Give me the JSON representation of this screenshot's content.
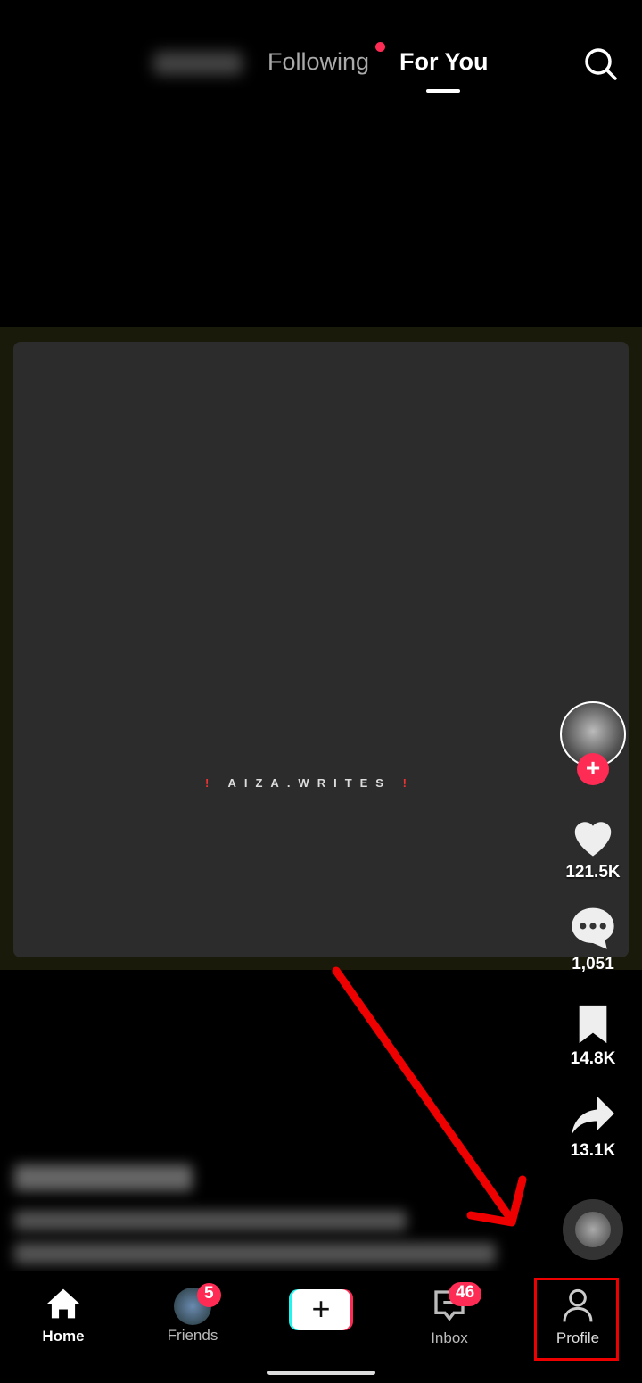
{
  "header": {
    "tabs": [
      {
        "label": "Following",
        "has_dot": true
      },
      {
        "label": "For You",
        "active": true
      }
    ],
    "search_icon": "search-icon"
  },
  "video": {
    "watermark_left": "!",
    "watermark_text": "AIZA.WRITES",
    "watermark_right": "!"
  },
  "actions": {
    "likes": "121.5K",
    "comments": "1,051",
    "saves": "14.8K",
    "shares": "13.1K"
  },
  "nav": {
    "items": [
      {
        "label": "Home",
        "active": true
      },
      {
        "label": "Friends",
        "badge": "5"
      },
      {
        "label": "",
        "icon": "plus-icon"
      },
      {
        "label": "Inbox",
        "badge": "46"
      },
      {
        "label": "Profile"
      }
    ]
  },
  "colors": {
    "accent": "#fe2c55",
    "annotation": "#ee0000"
  }
}
